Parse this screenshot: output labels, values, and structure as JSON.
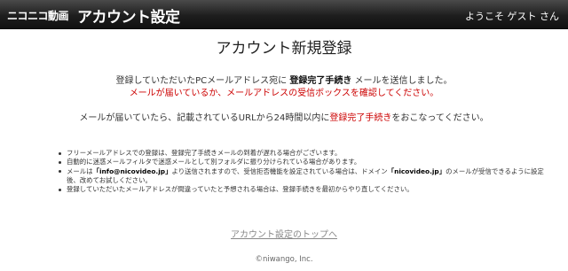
{
  "header": {
    "logo": "ニコニコ動画",
    "title": "アカウント設定",
    "welcome": "ようこそ ゲスト さん"
  },
  "main": {
    "title": "アカウント新規登録",
    "line1_pre": "登録していただいたPCメールアドレス宛に",
    "line1_bold": "登録完了手続き",
    "line1_post": "メールを送信しました。",
    "line2": "メールが届いているか、メールアドレスの受信ボックスを確認してください。",
    "line3_pre": "メールが届いていたら、記載されているURLから24時間以内に",
    "line3_red": "登録完了手続き",
    "line3_post": "をおこなってください。",
    "notes": [
      "フリーメールアドレスでの登録は、登録完了手続きメールの到着が遅れる場合がございます。",
      "自動的に迷惑メールフィルタで迷惑メールとして別フォルダに振り分けられている場合があります。",
      "登録していただいたメールアドレスが間違っていたと予想される場合は、登録手続きを最初からやり直してください。"
    ],
    "note3_a": "メールは",
    "note3_email": "「info@nicovideo.jp」",
    "note3_b": "より送信されますので、受信拒否機能を設定されている場合は、ドメイン",
    "note3_domain": "「nicovideo.jp」",
    "note3_c": "のメールが受信できるように設定後、改めてお試しください。",
    "top_link": "アカウント設定のトップへ",
    "copyright": "©niwango, Inc."
  }
}
